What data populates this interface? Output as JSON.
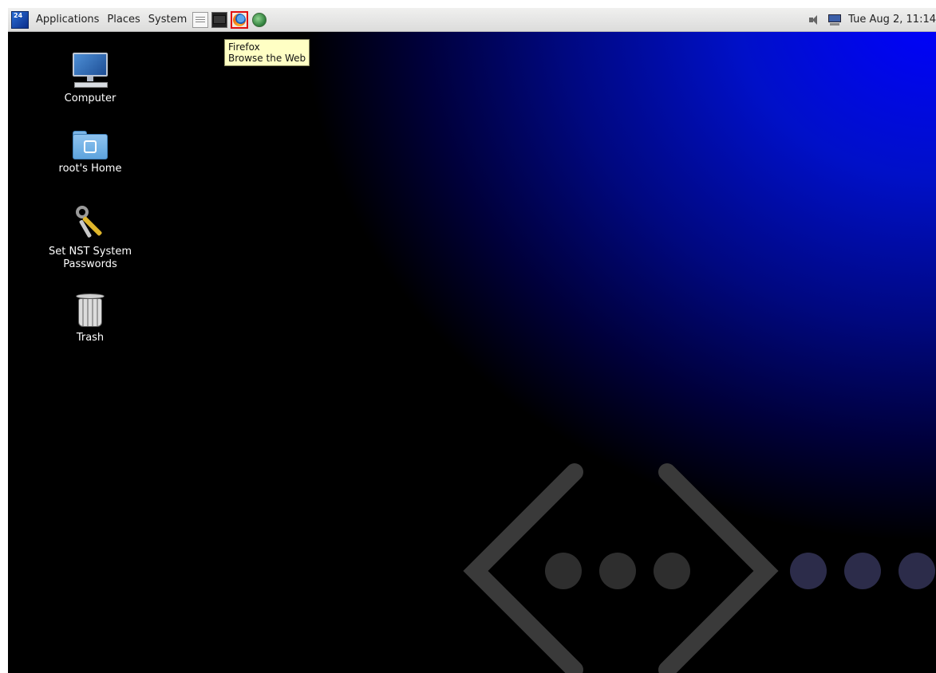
{
  "panel": {
    "menus": [
      "Applications",
      "Places",
      "System"
    ],
    "logo_text": "24",
    "launchers": [
      "text-editor-icon",
      "terminal-icon",
      "firefox-icon",
      "network-icon"
    ],
    "tray_icons": [
      "volume-icon",
      "network-status-icon"
    ],
    "clock": "Tue Aug  2, 11:14"
  },
  "tooltip": {
    "title": "Firefox",
    "subtitle": "Browse the Web"
  },
  "desktop": {
    "icons": [
      {
        "label": "Computer"
      },
      {
        "label": "root's Home"
      },
      {
        "label_line1": "Set NST System",
        "label_line2": "Passwords"
      },
      {
        "label": "Trash"
      }
    ]
  },
  "colors": {
    "wallpaper_accent": "#0000ff",
    "panel_bg": "#e6e6e5",
    "tooltip_bg": "#ffffc4",
    "launcher_highlight": "#e01010"
  }
}
